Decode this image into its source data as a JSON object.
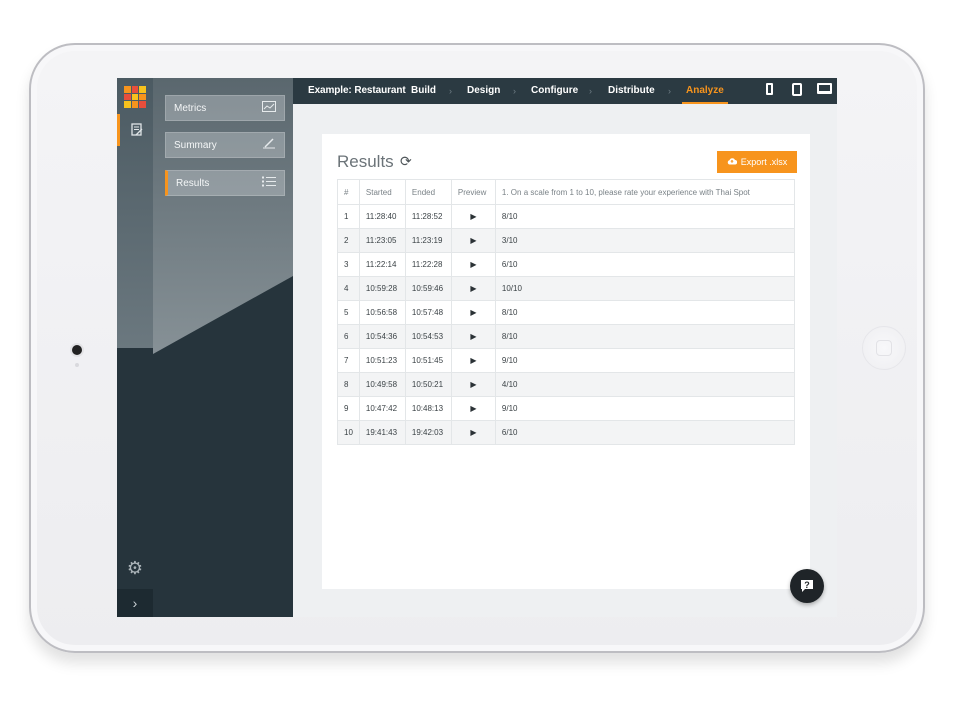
{
  "sidebar": {
    "items": [
      {
        "label": "Metrics",
        "icon": "chart-icon"
      },
      {
        "label": "Summary",
        "icon": "pencil-chart-icon"
      },
      {
        "label": "Results",
        "icon": "list-icon"
      }
    ]
  },
  "topbar": {
    "title": "Example: Restaurant",
    "steps": [
      "Build",
      "Design",
      "Configure",
      "Distribute",
      "Analyze"
    ],
    "active_step": "Analyze"
  },
  "results": {
    "title": "Results",
    "export_label": "Export .xlsx",
    "columns": [
      "#",
      "Started",
      "Ended",
      "Preview",
      "1. On a scale from 1 to 10, please rate your experience with Thai Spot"
    ],
    "rows": [
      [
        "1",
        "11:28:40",
        "11:28:52",
        "8/10"
      ],
      [
        "2",
        "11:23:05",
        "11:23:19",
        "3/10"
      ],
      [
        "3",
        "11:22:14",
        "11:22:28",
        "6/10"
      ],
      [
        "4",
        "10:59:28",
        "10:59:46",
        "10/10"
      ],
      [
        "5",
        "10:56:58",
        "10:57:48",
        "8/10"
      ],
      [
        "6",
        "10:54:36",
        "10:54:53",
        "8/10"
      ],
      [
        "7",
        "10:51:23",
        "10:51:45",
        "9/10"
      ],
      [
        "8",
        "10:49:58",
        "10:50:21",
        "4/10"
      ],
      [
        "9",
        "10:47:42",
        "10:48:13",
        "9/10"
      ],
      [
        "10",
        "19:41:43",
        "19:42:03",
        "6/10"
      ]
    ]
  },
  "help": {
    "label": "?"
  },
  "colors": {
    "accent": "#f7941d",
    "dark": "#26343c",
    "topbar": "#2b3a42"
  }
}
